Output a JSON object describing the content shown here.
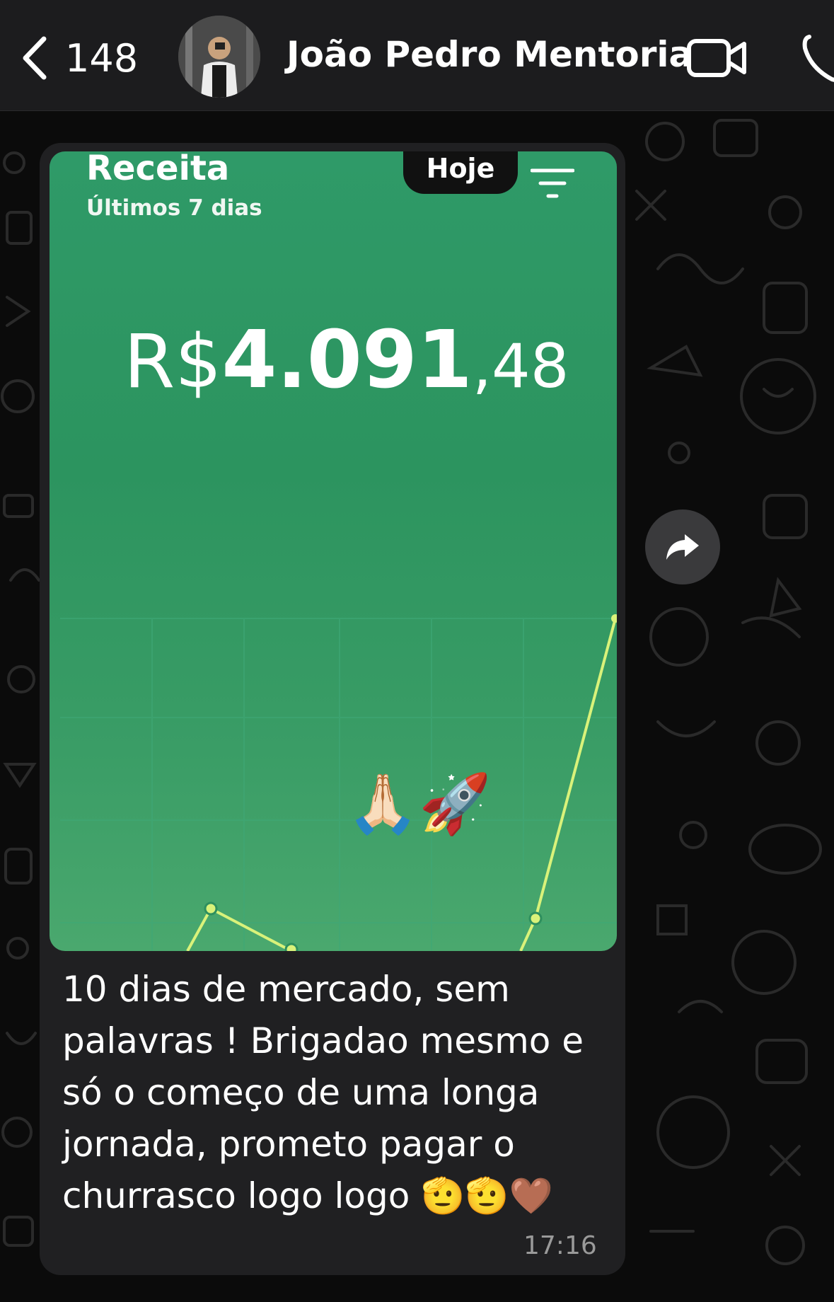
{
  "header": {
    "back_count": "148",
    "contact_name": "João Pedro Mentoria",
    "icons": [
      "back-chevron-icon",
      "avatar",
      "video-call-icon",
      "phone-call-icon"
    ]
  },
  "message": {
    "image": {
      "title": "Receita",
      "subtitle": "Últimos 7 dias",
      "filter_button": "Hoje",
      "amount_currency": "R$",
      "amount_integer": "4.091",
      "amount_decimal": ",48",
      "overlay_emojis": "🙏🏻🚀"
    },
    "text": "10 dias de mercado, sem palavras ! Brigadao mesmo e só o começo de uma longa jornada, prometo pagar o churrasco logo logo 🫡🫡🤎",
    "time": "17:16"
  },
  "colors": {
    "header_bg": "#1c1c1e",
    "bubble_bg": "#202022",
    "chart_green": "#2f9a68",
    "line_color": "#d9f27a"
  }
}
